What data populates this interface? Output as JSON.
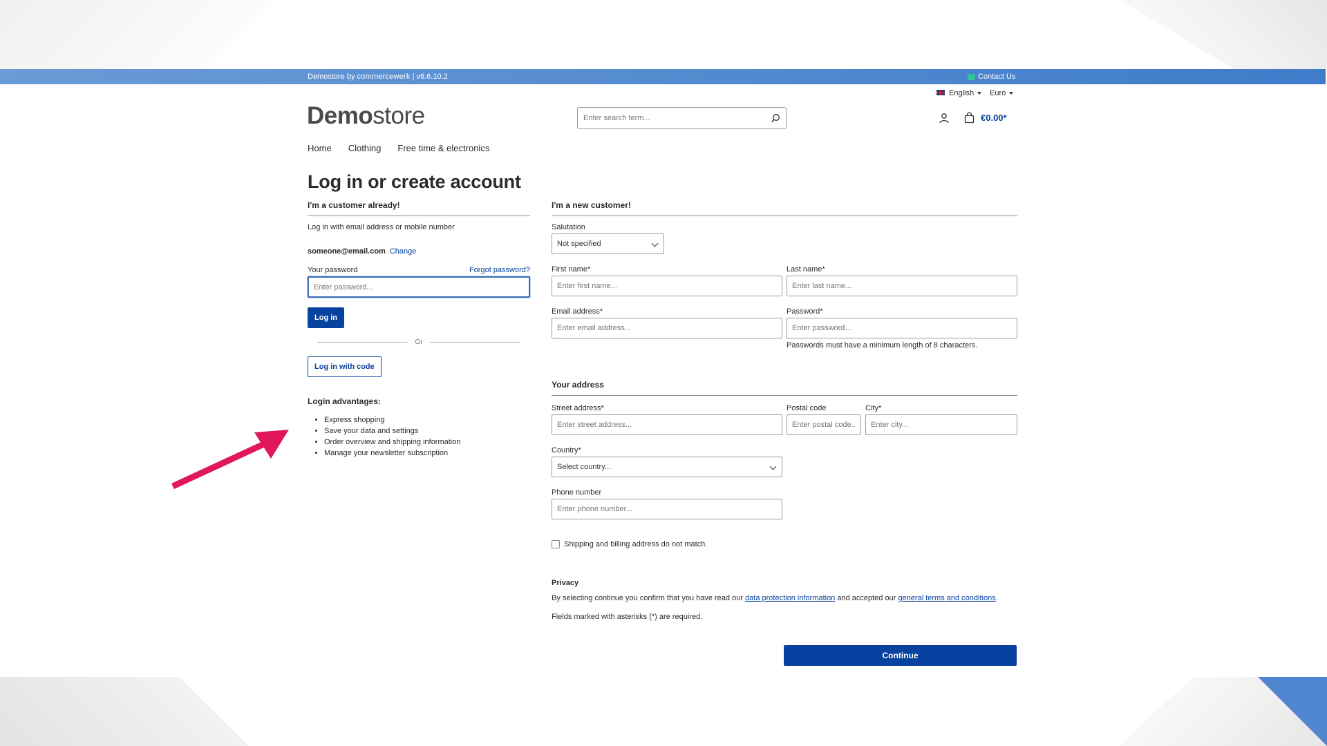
{
  "topbar": {
    "store_prefix": "Demostore by",
    "brand": "commercewerk",
    "version": "| v6.6.10.2",
    "contact": "Contact Us"
  },
  "locale": {
    "language": "English",
    "currency": "Euro"
  },
  "header": {
    "logo_bold": "Demo",
    "logo_regular": "store",
    "search_placeholder": "Enter search term...",
    "cart_total": "€0.00*"
  },
  "nav": {
    "items": [
      "Home",
      "Clothing",
      "Free time & electronics"
    ]
  },
  "page_title": "Log in or create account",
  "login": {
    "heading": "I'm a customer already!",
    "intro": "Log in with email address or mobile number",
    "email": "someone@email.com",
    "change": "Change",
    "password_label": "Your password",
    "forgot": "Forgot password?",
    "password_placeholder": "Enter password...",
    "login_button": "Log in",
    "or": "Or",
    "code_button": "Log in with code",
    "advantages_title": "Login advantages:",
    "advantages": [
      "Express shopping",
      "Save your data and settings",
      "Order overview and shipping information",
      "Manage your newsletter subscription"
    ]
  },
  "register": {
    "heading": "I'm a new customer!",
    "salutation_label": "Salutation",
    "salutation_value": "Not specified",
    "first_name_label": "First name*",
    "first_name_placeholder": "Enter first name...",
    "last_name_label": "Last name*",
    "last_name_placeholder": "Enter last name...",
    "email_label": "Email address*",
    "email_placeholder": "Enter email address...",
    "password_label": "Password*",
    "password_placeholder": "Enter password...",
    "password_hint": "Passwords must have a minimum length of 8 characters.",
    "address_heading": "Your address",
    "street_label": "Street address*",
    "street_placeholder": "Enter street address...",
    "postal_label": "Postal code",
    "postal_placeholder": "Enter postal code...",
    "city_label": "City*",
    "city_placeholder": "Enter city...",
    "country_label": "Country*",
    "country_value": "Select country...",
    "phone_label": "Phone number",
    "phone_placeholder": "Enter phone number...",
    "address_mismatch": "Shipping and billing address do not match.",
    "privacy_title": "Privacy",
    "privacy_before": "By selecting continue you confirm that you have read our ",
    "privacy_link1": "data protection information",
    "privacy_middle": " and accepted our ",
    "privacy_link2": "general terms and conditions",
    "privacy_after": ".",
    "required_note": "Fields marked with asterisks (*) are required.",
    "continue_button": "Continue"
  },
  "colors": {
    "primary": "#0842a0",
    "topbar": "#4f86cf",
    "annotation_arrow": "#e0185a"
  }
}
